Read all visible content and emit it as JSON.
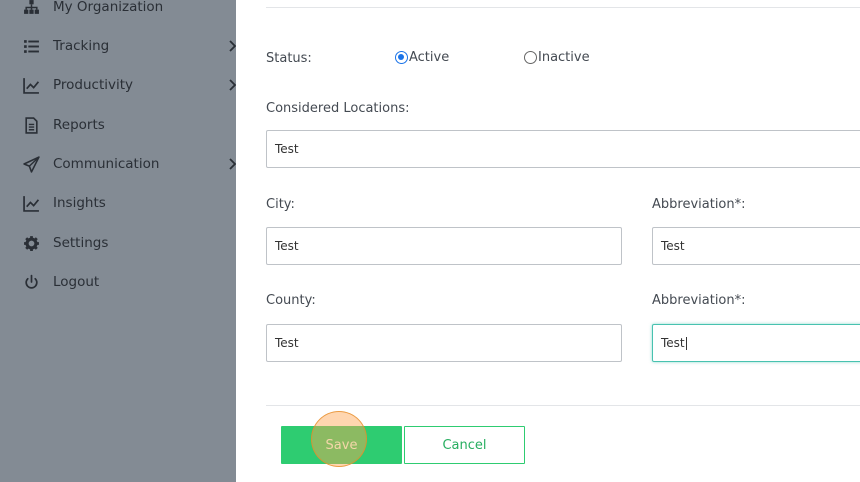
{
  "sidebar": {
    "items": [
      {
        "label": "My Organization",
        "icon": "org-chart-icon",
        "has_submenu": false
      },
      {
        "label": "Tracking",
        "icon": "list-icon",
        "has_submenu": true
      },
      {
        "label": "Productivity",
        "icon": "line-chart-icon",
        "has_submenu": true
      },
      {
        "label": "Reports",
        "icon": "document-icon",
        "has_submenu": false
      },
      {
        "label": "Communication",
        "icon": "paper-plane-icon",
        "has_submenu": true
      },
      {
        "label": "Insights",
        "icon": "line-chart-icon",
        "has_submenu": false
      },
      {
        "label": "Settings",
        "icon": "gear-icon",
        "has_submenu": false
      },
      {
        "label": "Logout",
        "icon": "power-icon",
        "has_submenu": false
      }
    ]
  },
  "form": {
    "status_label": "Status:",
    "status_options": [
      {
        "label": "Active",
        "checked": true
      },
      {
        "label": "Inactive",
        "checked": false
      }
    ],
    "considered_locations_label": "Considered Locations:",
    "considered_locations_value": "Test",
    "city_label": "City:",
    "city_value": "Test",
    "city_abbrev_label": "Abbreviation*:",
    "city_abbrev_value": "Test",
    "county_label": "County:",
    "county_value": "Test",
    "county_abbrev_label": "Abbreviation*:",
    "county_abbrev_value": "Test"
  },
  "actions": {
    "save_label": "Save",
    "cancel_label": "Cancel"
  },
  "colors": {
    "sidebar_bg": "#838b94",
    "save_bg": "#2ecc71",
    "focus_border": "#48c2b0",
    "radio_accent": "#1a73e8"
  }
}
